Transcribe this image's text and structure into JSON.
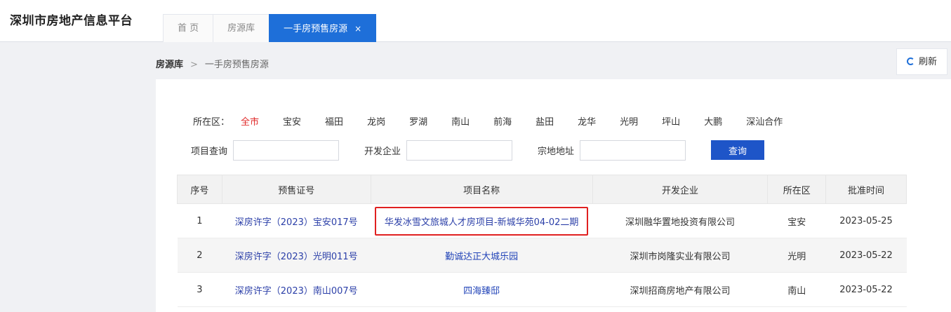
{
  "brand": "深圳市房地产信息平台",
  "tabs": [
    {
      "label": "首 页",
      "active": false
    },
    {
      "label": "房源库",
      "active": false
    },
    {
      "label": "一手房预售房源",
      "active": true,
      "close": "×"
    }
  ],
  "breadcrumb": {
    "root": "房源库",
    "separator": ">",
    "current": "一手房预售房源"
  },
  "refresh_label": "刷新",
  "filters": {
    "district_label": "所在区：",
    "districts": [
      "全市",
      "宝安",
      "福田",
      "龙岗",
      "罗湖",
      "南山",
      "前海",
      "盐田",
      "龙华",
      "光明",
      "坪山",
      "大鹏",
      "深汕合作"
    ],
    "selected_district": "全市",
    "project_label": "项目查询",
    "project_value": "",
    "developer_label": "开发企业",
    "developer_value": "",
    "parcel_label": "宗地地址",
    "parcel_value": "",
    "query_button": "查询"
  },
  "table": {
    "headers": [
      "序号",
      "预售证号",
      "项目名称",
      "开发企业",
      "所在区",
      "批准时间"
    ],
    "rows": [
      {
        "no": "1",
        "permit": "深房许字（2023）宝安017号",
        "project": "华发冰雪文旅城人才房项目-新城华苑04-02二期",
        "developer": "深圳融华置地投资有限公司",
        "district": "宝安",
        "date": "2023-05-25",
        "highlighted": true
      },
      {
        "no": "2",
        "permit": "深房许字（2023）光明011号",
        "project": "勤诚达正大城乐园",
        "developer": "深圳市岗隆实业有限公司",
        "district": "光明",
        "date": "2023-05-22",
        "highlighted": false
      },
      {
        "no": "3",
        "permit": "深房许字（2023）南山007号",
        "project": "四海臻邸",
        "developer": "深圳招商房地产有限公司",
        "district": "南山",
        "date": "2023-05-22",
        "highlighted": false
      }
    ]
  },
  "colors": {
    "accent": "#1e6fd9",
    "button": "#1e55c8",
    "selected_district": "#e02b2b",
    "highlight_box": "#e02020",
    "link": "#2b3fa8"
  }
}
